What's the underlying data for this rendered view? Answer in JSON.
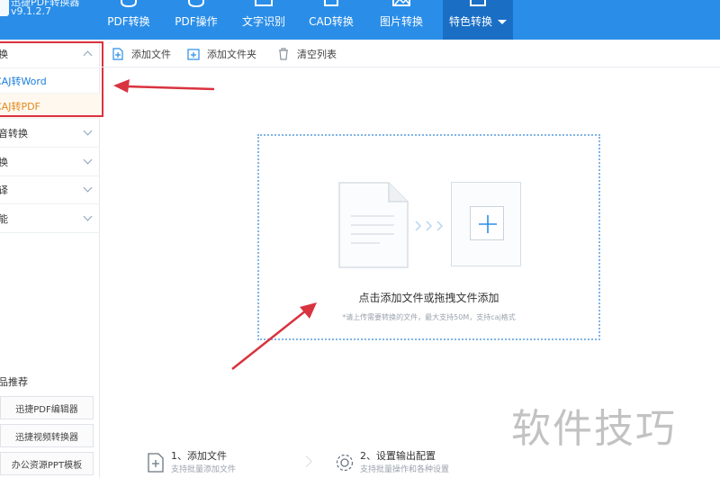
{
  "app": {
    "name": "迅捷PDF转换器",
    "version": "v9.1.2.7"
  },
  "nav": {
    "tabs": [
      {
        "label": "PDF转换",
        "icon": "convert-icon"
      },
      {
        "label": "PDF操作",
        "icon": "operate-icon"
      },
      {
        "label": "文字识别",
        "icon": "ocr-icon"
      },
      {
        "label": "CAD转换",
        "icon": "cad-icon"
      },
      {
        "label": "图片转换",
        "icon": "image-icon"
      },
      {
        "label": "特色转换",
        "icon": "special-icon",
        "active": true
      }
    ]
  },
  "sidebar": {
    "groups": [
      {
        "label": "换",
        "expanded": true
      },
      {
        "label": "音转换",
        "expanded": false
      },
      {
        "label": "换",
        "expanded": false
      },
      {
        "label": "译",
        "expanded": false
      },
      {
        "label": "能",
        "expanded": false
      }
    ],
    "sub_items": [
      {
        "label": "CAJ转Word"
      },
      {
        "label": "CAJ转PDF",
        "selected": true
      }
    ],
    "recommend_title": "品推荐",
    "recommend": [
      {
        "label": "迅捷PDF编辑器"
      },
      {
        "label": "迅捷视频转换器"
      },
      {
        "label": "办公资源PPT模板"
      }
    ]
  },
  "toolbar": {
    "add_file": "添加文件",
    "add_folder": "添加文件夹",
    "clear_list": "清空列表"
  },
  "dropzone": {
    "main_text": "点击添加文件或拖拽文件添加",
    "hint_text": "*请上传需要转换的文件，最大支持50M，支持caj格式"
  },
  "steps": [
    {
      "title": "1、添加文件",
      "sub": "支持批量添加文件"
    },
    {
      "title": "2、设置输出配置",
      "sub": "支持批量操作和各种设置"
    }
  ],
  "watermark": "软件技巧",
  "colors": {
    "topbar": "#2a8ee8",
    "active_tab": "#1a6fc5",
    "annotation": "#d9333f",
    "link_blue": "#1d7fdc",
    "selected_orange": "#e08a1e"
  }
}
